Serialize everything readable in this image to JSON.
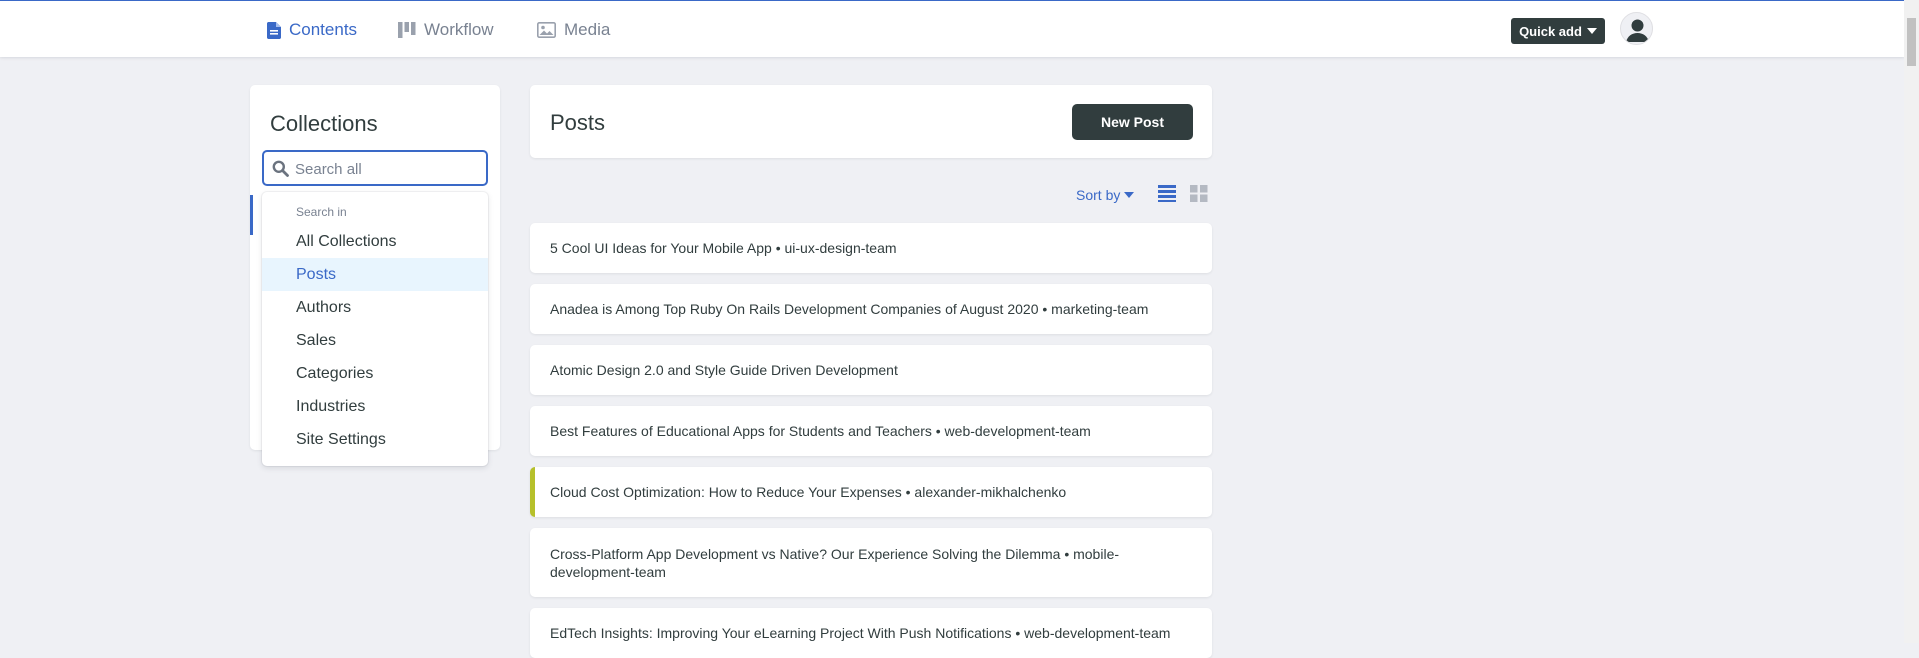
{
  "nav": {
    "contents": "Contents",
    "workflow": "Workflow",
    "media": "Media"
  },
  "header": {
    "quick_add": "Quick add"
  },
  "sidebar": {
    "title": "Collections",
    "search_placeholder": "Search all",
    "search_value": ""
  },
  "dropdown": {
    "header": "Search in",
    "items": [
      {
        "label": "All Collections",
        "selected": false
      },
      {
        "label": "Posts",
        "selected": true
      },
      {
        "label": "Authors",
        "selected": false
      },
      {
        "label": "Sales",
        "selected": false
      },
      {
        "label": "Categories",
        "selected": false
      },
      {
        "label": "Industries",
        "selected": false
      },
      {
        "label": "Site Settings",
        "selected": false
      }
    ]
  },
  "main": {
    "title": "Posts",
    "new_button": "New Post",
    "sort_label": "Sort by",
    "rows": [
      {
        "text": "5 Cool UI Ideas for Your Mobile App • ui-ux-design-team",
        "flagged": false
      },
      {
        "text": "Anadea is Among Top Ruby On Rails Development Companies of August 2020 • marketing-team",
        "flagged": false
      },
      {
        "text": "Atomic Design 2.0 and Style Guide Driven Development",
        "flagged": false
      },
      {
        "text": "Best Features of Educational Apps for Students and Teachers • web-development-team",
        "flagged": false
      },
      {
        "text": "Cloud Cost Optimization: How to Reduce Your Expenses • alexander-mikhalchenko",
        "flagged": true
      },
      {
        "text": "Cross-Platform App Development vs Native? Our Experience Solving the Dilemma • mobile-development-team",
        "flagged": false
      },
      {
        "text": "EdTech Insights: Improving Your eLearning Project With Push Notifications • web-development-team",
        "flagged": false
      }
    ]
  },
  "colors": {
    "accent": "#3a69c7",
    "dark": "#313d3e",
    "muted": "#798291",
    "background": "#eff0f4",
    "selected_bg": "#e8f5fe",
    "flag": "#b6c02b"
  },
  "icons": {
    "contents": "document-icon",
    "workflow": "kanban-icon",
    "media": "image-icon",
    "search": "search-icon",
    "avatar": "user-icon",
    "list_view": "list-view-icon",
    "grid_view": "grid-view-icon"
  }
}
